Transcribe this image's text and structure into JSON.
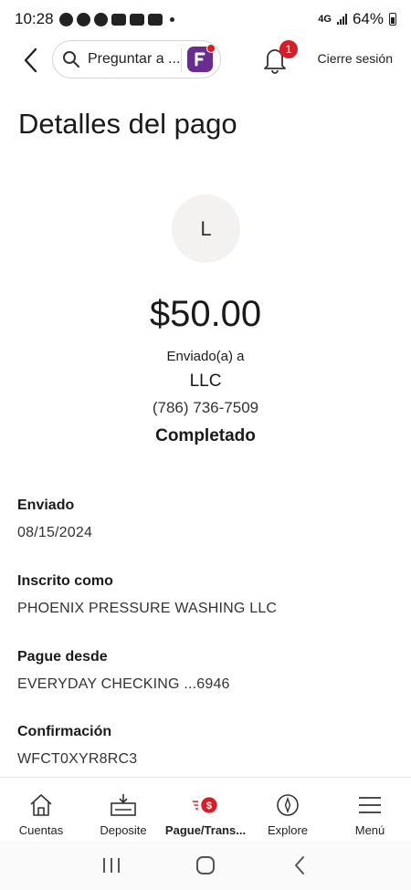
{
  "status_bar": {
    "time": "10:28",
    "network": "4G",
    "battery": "64%"
  },
  "header": {
    "search_placeholder": "Preguntar a ...",
    "notification_count": "1",
    "signout_label": "Cierre sesión"
  },
  "page": {
    "title": "Detalles del pago"
  },
  "payment": {
    "avatar_initial": "L",
    "amount": "$50.00",
    "sent_to_label": "Enviado(a) a",
    "payee_name": "LLC",
    "payee_phone": "(786) 736-7509",
    "status": "Completado"
  },
  "details": [
    {
      "label": "Enviado",
      "value": "08/15/2024"
    },
    {
      "label": "Inscrito como",
      "value": "PHOENIX PRESSURE WASHING LLC"
    },
    {
      "label": "Pague desde",
      "value": "EVERYDAY CHECKING ...6946"
    },
    {
      "label": "Confirmación",
      "value": "WFCT0XYR8RC3"
    }
  ],
  "bottom_nav": [
    {
      "label": "Cuentas",
      "icon": "house-icon"
    },
    {
      "label": "Deposite",
      "icon": "deposit-icon"
    },
    {
      "label": "Pague/Trans...",
      "icon": "pay-transfer-icon"
    },
    {
      "label": "Explore",
      "icon": "compass-icon"
    },
    {
      "label": "Menú",
      "icon": "hamburger-menu-icon"
    }
  ],
  "colors": {
    "accent_red": "#d71e28",
    "assistant_purple": "#6b2c91",
    "avatar_bg": "#f3f2f1"
  }
}
